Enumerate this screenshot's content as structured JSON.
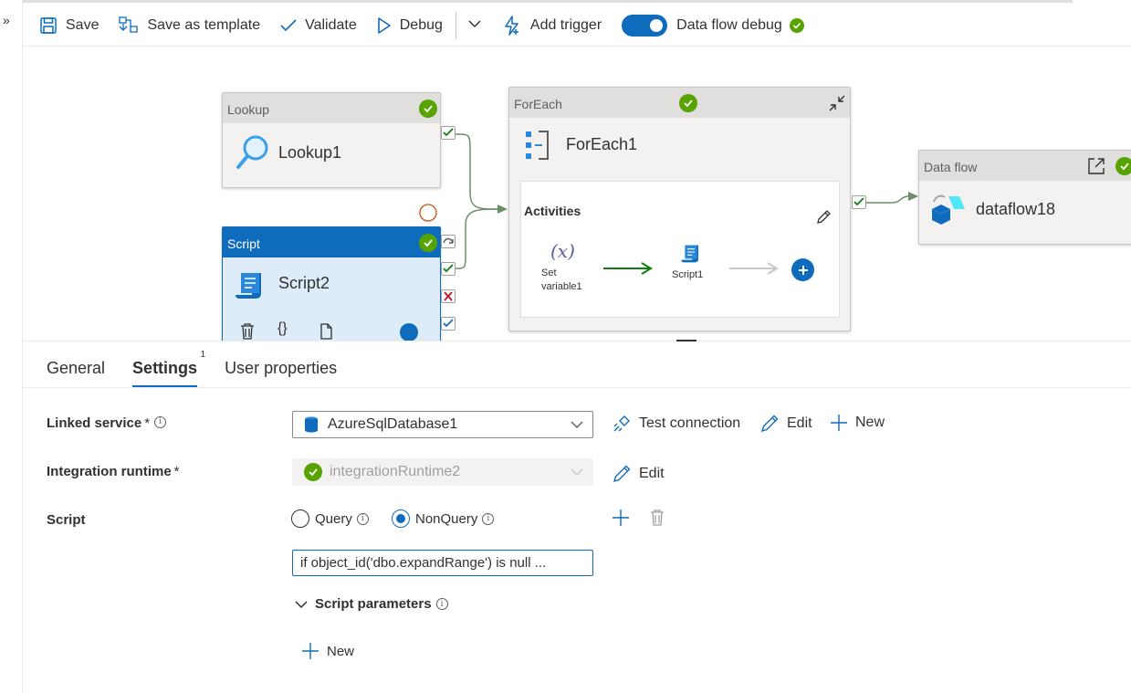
{
  "rail": {
    "expand_glyph": "»"
  },
  "toolbar": {
    "save": "Save",
    "save_template": "Save as template",
    "validate": "Validate",
    "debug": "Debug",
    "add_trigger": "Add trigger",
    "dataflow_debug": "Data flow debug",
    "dataflow_debug_on": true
  },
  "canvas": {
    "lookup": {
      "type": "Lookup",
      "name": "Lookup1"
    },
    "script": {
      "type": "Script",
      "name": "Script2"
    },
    "foreach": {
      "type": "ForEach",
      "name": "ForEach1",
      "activities_label": "Activities",
      "inner": [
        {
          "glyph": "(x)",
          "label_line1": "Set",
          "label_line2": "variable1"
        },
        {
          "label": "Script1"
        }
      ]
    },
    "dataflow": {
      "type": "Data flow",
      "name": "dataflow18"
    }
  },
  "tabs": [
    {
      "label": "General"
    },
    {
      "label": "Settings",
      "badge": "1",
      "active": true
    },
    {
      "label": "User properties"
    }
  ],
  "settings": {
    "linked_service": {
      "label": "Linked service",
      "required": "*",
      "value": "AzureSqlDatabase1",
      "db_tag": "SQL"
    },
    "linked_actions": {
      "test": "Test connection",
      "edit": "Edit",
      "new": "New"
    },
    "integration_runtime": {
      "label": "Integration runtime",
      "required": "*",
      "value": "integrationRuntime2",
      "edit": "Edit"
    },
    "script": {
      "label": "Script",
      "query": "Query",
      "nonquery": "NonQuery",
      "selected": "NonQuery",
      "text": "if object_id('dbo.expandRange') is null ..."
    },
    "script_params": {
      "label": "Script parameters",
      "new": "New"
    }
  },
  "colors": {
    "accent": "#0f6cbd",
    "success": "#57a300",
    "error": "#c50f1f",
    "edge": "#6b8e6b"
  }
}
